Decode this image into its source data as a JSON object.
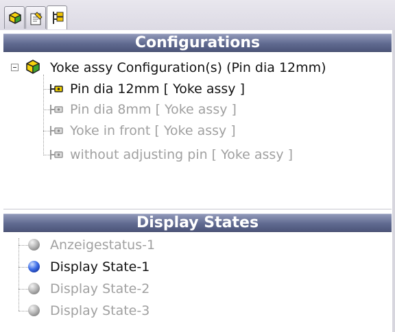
{
  "tabs": [
    {
      "name": "feature-manager-tab",
      "icon": "feature-tree-icon"
    },
    {
      "name": "property-manager-tab",
      "icon": "property-icon"
    },
    {
      "name": "configuration-manager-tab",
      "icon": "configuration-tree-icon",
      "active": true
    }
  ],
  "configurations": {
    "header": "Configurations",
    "root_label": "Yoke assy Configuration(s)  (Pin dia 12mm)",
    "items": [
      {
        "label": "Pin dia 12mm [ Yoke assy ]",
        "active": true
      },
      {
        "label": "Pin dia 8mm [ Yoke assy ]",
        "active": false
      },
      {
        "label": "Yoke in front [ Yoke assy ]",
        "active": false
      },
      {
        "label": "without adjusting pin [ Yoke assy ]",
        "active": false
      }
    ]
  },
  "display_states": {
    "header": "Display States",
    "items": [
      {
        "label": "Anzeigestatus-1",
        "active": false
      },
      {
        "label": "Display State-1",
        "active": true
      },
      {
        "label": "Display State-2",
        "active": false
      },
      {
        "label": "Display State-3",
        "active": false
      }
    ]
  },
  "colors": {
    "header_bg": "#606a90",
    "active_text": "#111111",
    "inactive_text": "#a0a0a0",
    "active_ball": "#3f6fe8",
    "config_icon_yellow": "#f0d000"
  }
}
